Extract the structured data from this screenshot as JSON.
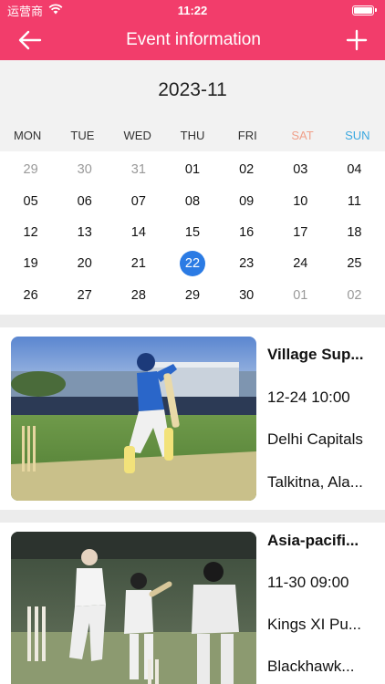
{
  "status_bar": {
    "carrier": "运营商",
    "time": "11:22"
  },
  "navbar": {
    "title": "Event information",
    "back_icon": "back-arrow-icon",
    "add_icon": "plus-icon"
  },
  "calendar": {
    "month": "2023-11",
    "weekdays": [
      "MON",
      "TUE",
      "WED",
      "THU",
      "FRI",
      "SAT",
      "SUN"
    ],
    "weekday_colors": {
      "SAT": "#f0a08a",
      "SUN": "#3aa8e0"
    },
    "days": [
      {
        "d": "29",
        "muted": true
      },
      {
        "d": "30",
        "muted": true
      },
      {
        "d": "31",
        "muted": true
      },
      {
        "d": "01"
      },
      {
        "d": "02"
      },
      {
        "d": "03"
      },
      {
        "d": "04"
      },
      {
        "d": "05"
      },
      {
        "d": "06"
      },
      {
        "d": "07"
      },
      {
        "d": "08"
      },
      {
        "d": "09"
      },
      {
        "d": "10"
      },
      {
        "d": "11"
      },
      {
        "d": "12"
      },
      {
        "d": "13"
      },
      {
        "d": "14"
      },
      {
        "d": "15"
      },
      {
        "d": "16"
      },
      {
        "d": "17"
      },
      {
        "d": "18"
      },
      {
        "d": "19"
      },
      {
        "d": "20"
      },
      {
        "d": "21"
      },
      {
        "d": "22",
        "selected": true
      },
      {
        "d": "23"
      },
      {
        "d": "24"
      },
      {
        "d": "25"
      },
      {
        "d": "26"
      },
      {
        "d": "27"
      },
      {
        "d": "28"
      },
      {
        "d": "29"
      },
      {
        "d": "30"
      },
      {
        "d": "01",
        "muted": true
      },
      {
        "d": "02",
        "muted": true
      }
    ],
    "selected_color": "#2b7be4"
  },
  "events": [
    {
      "name": "Village Sup...",
      "time": "12-24 10:00",
      "team": "Delhi Capitals",
      "place": "Talkitna, Ala..."
    },
    {
      "name": "Asia-pacifi...",
      "time": "11-30 09:00",
      "team": "Kings XI Pu...",
      "place": "Blackhawk..."
    }
  ],
  "colors": {
    "accent": "#f23d6b"
  }
}
